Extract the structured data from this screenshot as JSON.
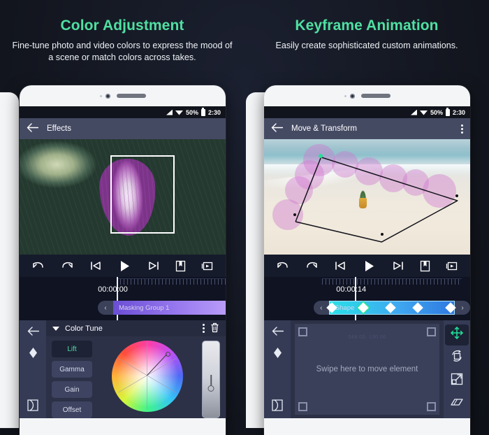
{
  "left_panel": {
    "title": "Color Adjustment",
    "subtitle": "Fine-tune photo and video colors to express the mood of a scene or match colors across takes.",
    "phone": {
      "status_bar": {
        "battery_percent": "50%",
        "clock": "2:30"
      },
      "app_bar": {
        "title": "Effects",
        "back_icon": "arrow-left-icon"
      },
      "preview": {
        "image_alt": "hosta-leaves-photo",
        "selection": "selection-rectangle"
      },
      "transport": {
        "undo": "undo-icon",
        "redo": "redo-icon",
        "skip_start": "skip-to-start-icon",
        "play": "play-icon",
        "skip_end": "skip-to-end-icon",
        "bookmark": "add-bookmark-icon",
        "capture": "capture-frame-icon"
      },
      "timeline": {
        "timecode": "00:00:00",
        "clip_label": "Masking Group 1",
        "nav_left": "‹"
      },
      "editor": {
        "panel_title": "Color Tune",
        "collapse_icon": "triangle-down-icon",
        "menu_icon": "kebab-menu-icon",
        "delete_icon": "trash-icon",
        "rail": {
          "back": "arrow-left-icon",
          "keyframe": "keyframe-diamond-icon",
          "mask": "mask-shape-icon"
        },
        "ranges": [
          {
            "label": "Lift",
            "active": true
          },
          {
            "label": "Gamma",
            "active": false
          },
          {
            "label": "Gain",
            "active": false
          },
          {
            "label": "Offset",
            "active": false
          }
        ],
        "color_wheel": "color-wheel",
        "luma_slider": "luminance-slider"
      }
    }
  },
  "right_panel": {
    "title": "Keyframe Animation",
    "subtitle": "Easily create sophisticated custom animations.",
    "phone": {
      "status_bar": {
        "battery_percent": "50%",
        "clock": "2:30"
      },
      "app_bar": {
        "title": "Move & Transform",
        "back_icon": "arrow-left-icon",
        "menu_icon": "kebab-menu-icon"
      },
      "preview": {
        "image_alt": "beach-pineapple-photo",
        "overlay": "keyframe-motion-path"
      },
      "transport": {
        "undo": "undo-icon",
        "redo": "redo-icon",
        "skip_start": "skip-to-start-icon",
        "play": "play-icon",
        "skip_end": "skip-to-end-icon",
        "bookmark": "add-bookmark-icon",
        "capture": "capture-frame-icon"
      },
      "timeline": {
        "timecode": "00:00:14",
        "clip_label": "Shape",
        "nav_left": "‹",
        "nav_right": "›"
      },
      "editor": {
        "rail": {
          "back": "arrow-left-icon",
          "keyframe": "keyframe-diamond-icon",
          "mask": "mask-shape-icon"
        },
        "swipe_pad": {
          "coordinates": "548.00, 130.00",
          "hint": "Swipe here to move element"
        },
        "tools": [
          {
            "name": "move-tool",
            "icon": "move-arrows-icon",
            "active": true
          },
          {
            "name": "rotate-tool",
            "icon": "rotate-icon",
            "active": false
          },
          {
            "name": "scale-tool",
            "icon": "scale-icon",
            "active": false
          },
          {
            "name": "skew-tool",
            "icon": "skew-icon",
            "active": false
          }
        ]
      }
    }
  },
  "colors": {
    "accent": "#4fe0a2",
    "background": "#141821",
    "appbar": "#454a63",
    "panel": "#2c3147",
    "clip_mask": "#9a7bf0",
    "clip_shape": "#3fa8f0"
  }
}
